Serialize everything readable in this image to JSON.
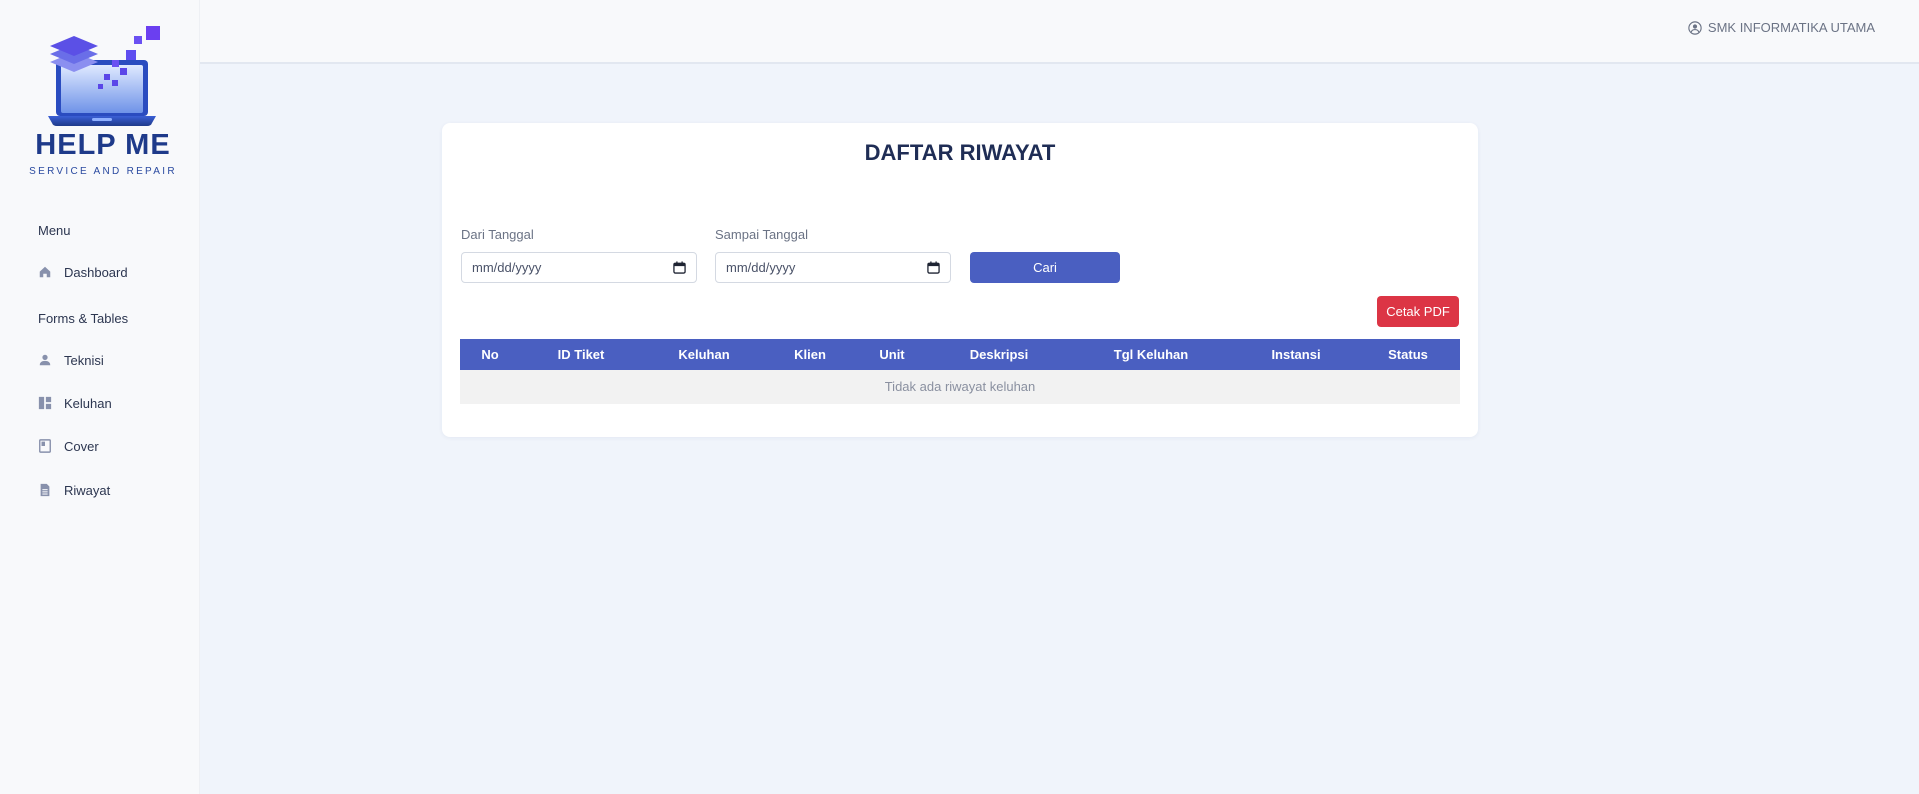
{
  "brand": {
    "title": "HELP ME",
    "subtitle": "SERVICE AND REPAIR"
  },
  "sidebar": {
    "sections": [
      {
        "heading": "Menu",
        "items": [
          {
            "label": "Dashboard",
            "icon": "home-icon"
          }
        ]
      },
      {
        "heading": "Forms & Tables",
        "items": [
          {
            "label": "Teknisi",
            "icon": "user-icon"
          },
          {
            "label": "Keluhan",
            "icon": "dashboard-grid-icon"
          },
          {
            "label": "Cover",
            "icon": "book-icon"
          },
          {
            "label": "Riwayat",
            "icon": "document-icon"
          }
        ]
      }
    ]
  },
  "topbar": {
    "user_name": "SMK INFORMATIKA UTAMA",
    "user_icon": "user-circle-icon"
  },
  "main": {
    "title": "DAFTAR RIWAYAT",
    "filter": {
      "from_label": "Dari Tanggal",
      "from_placeholder": "mm/dd/yyyy",
      "to_label": "Sampai Tanggal",
      "to_placeholder": "mm/dd/yyyy",
      "search_label": "Cari"
    },
    "print_label": "Cetak PDF",
    "table": {
      "columns": [
        "No",
        "ID Tiket",
        "Keluhan",
        "Klien",
        "Unit",
        "Deskripsi",
        "Tgl Keluhan",
        "Instansi",
        "Status"
      ],
      "rows": [],
      "empty_message": "Tidak ada riwayat keluhan"
    }
  },
  "colors": {
    "accent": "#4a5fc1",
    "danger": "#dc3545",
    "brand": "#1e3a8a",
    "page_bg": "#f0f4fb",
    "sidebar_bg": "#f8f9fb"
  }
}
